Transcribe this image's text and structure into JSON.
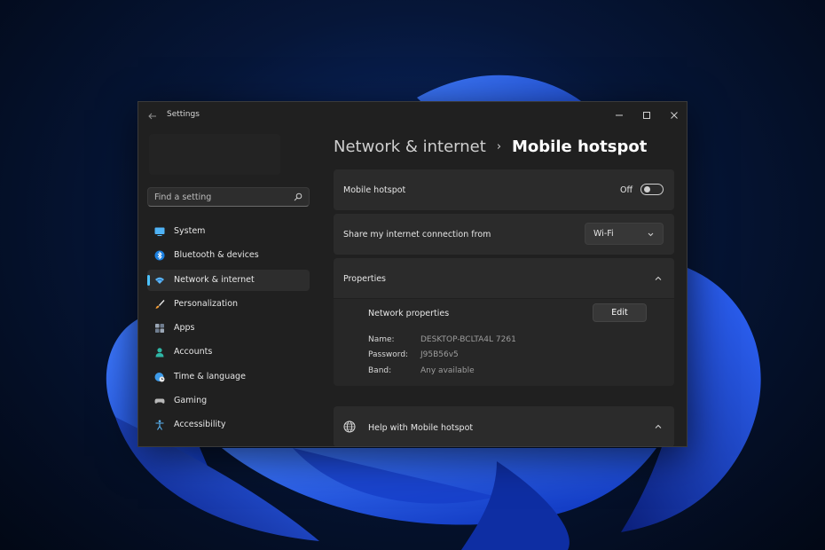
{
  "window": {
    "title": "Settings"
  },
  "search": {
    "placeholder": "Find a setting"
  },
  "sidebar": {
    "items": [
      {
        "label": "System",
        "icon": "monitor-icon"
      },
      {
        "label": "Bluetooth & devices",
        "icon": "bluetooth-icon"
      },
      {
        "label": "Network & internet",
        "icon": "wifi-icon",
        "active": true
      },
      {
        "label": "Personalization",
        "icon": "brush-icon"
      },
      {
        "label": "Apps",
        "icon": "apps-grid-icon"
      },
      {
        "label": "Accounts",
        "icon": "person-icon"
      },
      {
        "label": "Time & language",
        "icon": "globe-clock-icon"
      },
      {
        "label": "Gaming",
        "icon": "gamepad-icon"
      },
      {
        "label": "Accessibility",
        "icon": "accessibility-icon"
      }
    ]
  },
  "breadcrumb": {
    "parent": "Network & internet",
    "separator": "›",
    "current": "Mobile hotspot"
  },
  "hotspot": {
    "label": "Mobile hotspot",
    "state_label": "Off",
    "enabled": false
  },
  "share": {
    "label": "Share my internet connection from",
    "value": "Wi-Fi"
  },
  "properties": {
    "label": "Properties",
    "network_properties_label": "Network properties",
    "edit_label": "Edit",
    "name_key": "Name:",
    "name_value": "DESKTOP-BCLTA4L 7261",
    "password_key": "Password:",
    "password_value": "J95B56v5",
    "band_key": "Band:",
    "band_value": "Any available"
  },
  "help": {
    "label": "Help with Mobile hotspot"
  },
  "colors": {
    "accent": "#4cc2ff",
    "window_bg": "#202020",
    "card_bg": "#2b2b2b"
  }
}
